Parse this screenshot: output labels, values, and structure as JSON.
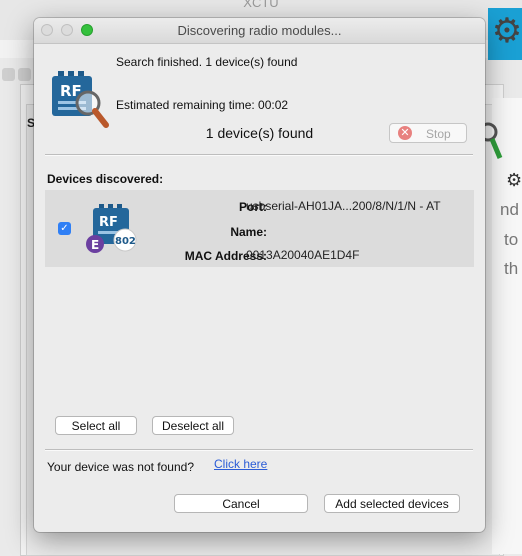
{
  "background_app": {
    "title": "XCTU",
    "panel_label": "S",
    "right_text": [
      "nd",
      "to",
      "th"
    ]
  },
  "dialog": {
    "title": "Discovering radio modules...",
    "icon": "radio-module-magnifier-icon",
    "status": "Search finished. 1 device(s) found",
    "remaining": "Estimated remaining time: 00:02",
    "found_count": "1 device(s) found",
    "stop_label": "Stop",
    "devices_header": "Devices discovered:",
    "devices": [
      {
        "checked": true,
        "icon_text": "RF",
        "badge_letter": "E",
        "badge_protocol": "802",
        "port_label": "Port:",
        "port_value": "usbserial-AH01JA...200/8/N/1/N - AT",
        "name_label": "Name:",
        "name_value": "",
        "mac_label": "MAC Address:",
        "mac_value": "0013A20040AE1D4F"
      }
    ],
    "select_all_label": "Select all",
    "deselect_all_label": "Deselect all",
    "not_found_text": "Your device was not found?",
    "click_here_label": "Click here",
    "cancel_label": "Cancel",
    "add_selected_label": "Add selected devices"
  },
  "colors": {
    "accent": "#1aa0d4",
    "checkbox": "#2f7ff5",
    "link": "#2b5cd6",
    "stop_icon": "#e8817f",
    "maximize": "#35c13d"
  }
}
